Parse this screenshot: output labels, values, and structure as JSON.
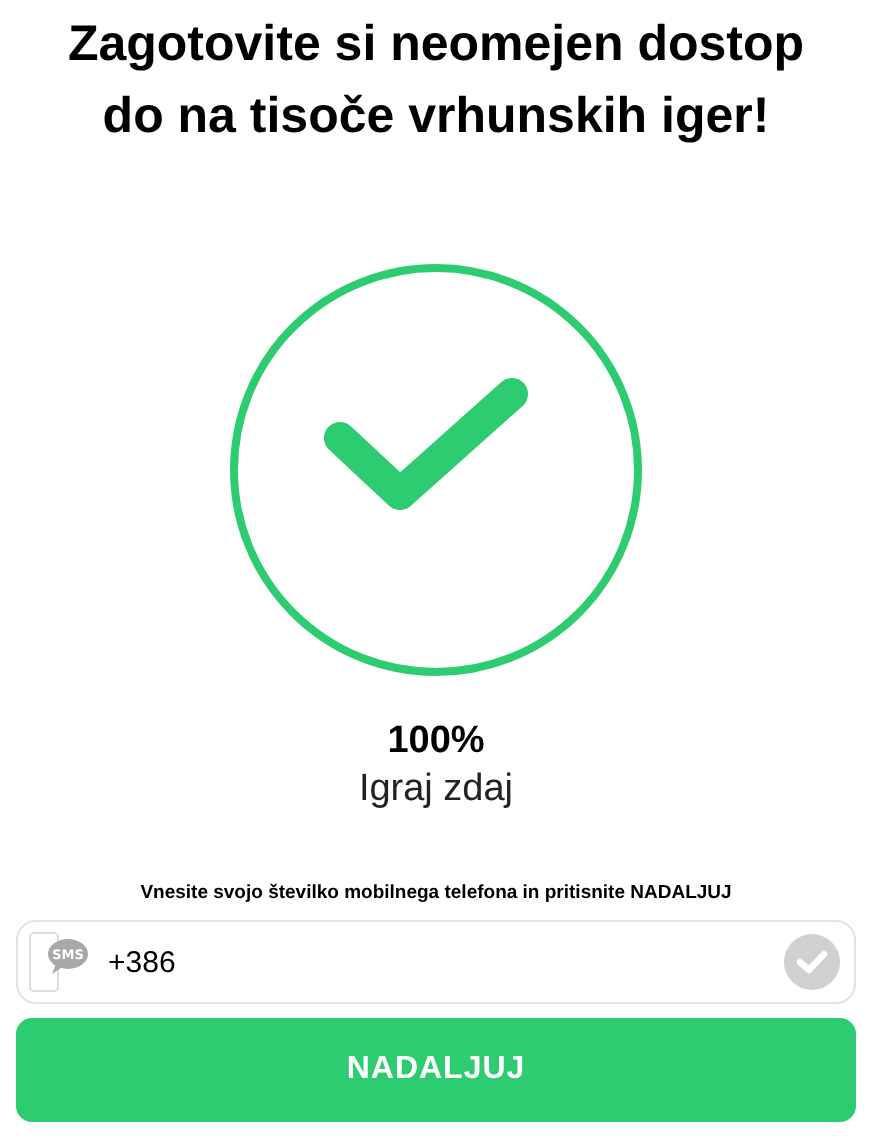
{
  "headline": "Zagotovite si neomejen dostop do na tisoče vrhunskih iger!",
  "progress": {
    "percent": "100%",
    "caption": "Igraj zdaj"
  },
  "instruction": "Vnesite svojo številko mobilnega telefona in pritisnite NADALJUJ",
  "phone_field": {
    "icon_label": "SMS",
    "value": "+386"
  },
  "submit_button": "NADALJUJ"
}
